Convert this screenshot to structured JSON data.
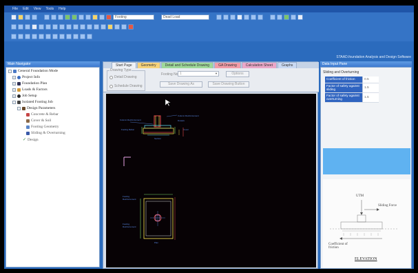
{
  "menubar": {
    "items": [
      "File",
      "Edit",
      "View",
      "Tools",
      "Help"
    ]
  },
  "toolbar": {
    "combo_footing": "Footing",
    "combo_load": "Dead Load"
  },
  "window": {
    "brand": "STAAD.foundation Analysis and Design Software"
  },
  "left_panel": {
    "title": "Main Navigator",
    "tree": [
      {
        "label": "General Foundation Mode",
        "icon": "folder-icon"
      },
      {
        "label": "Project Info",
        "icon": "info-icon"
      },
      {
        "label": "Foundation Plan",
        "icon": "plan-icon"
      },
      {
        "label": "Loads & Factors",
        "icon": "loads-icon"
      },
      {
        "label": "Job Setup",
        "icon": "setup-icon"
      },
      {
        "label": "Isolated Footing Job",
        "icon": "footing-icon"
      },
      {
        "label": "Design Parameters",
        "icon": "parameters-icon"
      },
      {
        "label": "Concrete & Rebar",
        "icon": "concrete-icon"
      },
      {
        "label": "Cover & Soil",
        "icon": "soil-icon"
      },
      {
        "label": "Footing Geometry",
        "icon": "geometry-icon"
      },
      {
        "label": "Sliding & Overturning",
        "icon": "sliding-icon"
      },
      {
        "label": "Design",
        "icon": "check-icon"
      }
    ]
  },
  "center": {
    "tabs": [
      "Start Page",
      "Geometry",
      "Detail and Schedule Drawing",
      "GA Drawing",
      "Calculation Sheet",
      "Graphs"
    ],
    "drawing_type_legend": "Drawing Type",
    "radio_detail": "Detail Drawing",
    "radio_schedule": "Schedule Drawing",
    "footing_no_label": "Footing No.",
    "footing_no_value": "1",
    "options_button": "Options",
    "save_drawing_button": "Save Drawing As",
    "save_drawing_button2": "Save Drawing Button"
  },
  "right_panel": {
    "title": "Data Input Pane",
    "group_title": "Sliding and Overturning",
    "properties": [
      {
        "key": "Coefficient of friction",
        "value": "0.5"
      },
      {
        "key": "Factor of safety against sliding",
        "value": "1.5"
      },
      {
        "key": "Factor of safety against overturning",
        "value": "1.5"
      }
    ],
    "diagram": {
      "label_top": "UTM",
      "label_sliding": "Sliding Force",
      "label_coef": "Coefficient of friction",
      "label_elev": "ELEVATION"
    }
  },
  "colors": {
    "accent": "#2b6bbd",
    "canvas": "#070205",
    "help_band": "#5fb2f1",
    "prop_key": "#2f64c0"
  }
}
